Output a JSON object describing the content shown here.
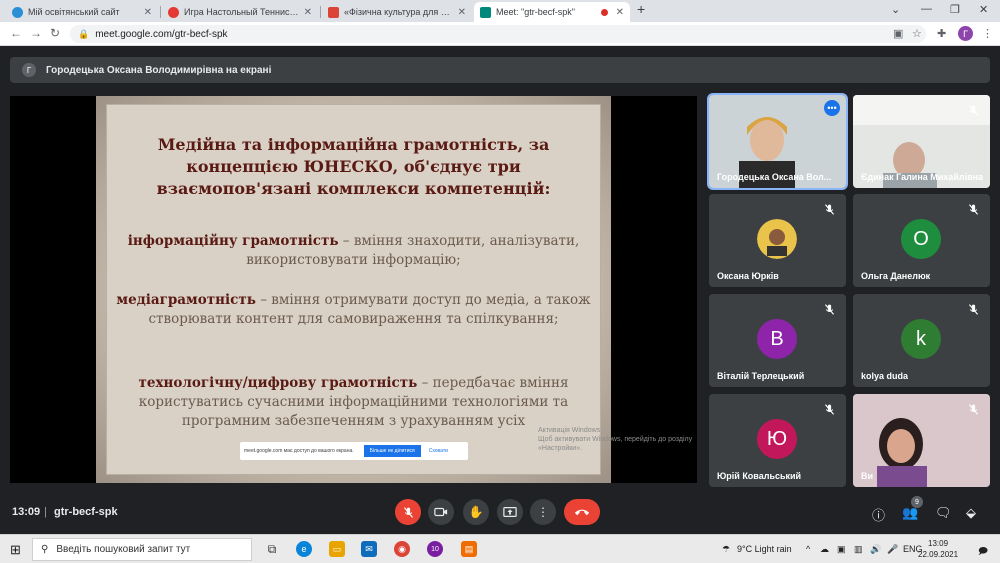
{
  "browser": {
    "tabs": [
      {
        "title": "Мій освітянський сайт",
        "favicon_color": "#2a8fd6",
        "active": false
      },
      {
        "title": "Игра Настольный Теннис: Мир...",
        "favicon_color": "#e53935",
        "active": false
      },
      {
        "title": "«Фізична культура для «поколі...",
        "favicon_color": "#db4437",
        "active": false
      },
      {
        "title": "Meet: \"gtr-becf-spk\"",
        "favicon_color": "#00897b",
        "active": true
      }
    ],
    "new_tab_icon": "plus-icon",
    "url": "meet.google.com/gtr-becf-spk",
    "profile_initial": "Г"
  },
  "meet": {
    "presenter_initial": "Г",
    "presenter_text": "Городецька Оксана Володимирівна на екрані",
    "slide": {
      "title_lines": [
        "Медійна та інформаційна грамотність, за",
        "концепцією ЮНЕСКО, об'єднує три",
        "взаємопов'язані комплекси компетенцій:"
      ],
      "p1_bold": "інформаційну грамотність",
      "p1_rest": " – вміння знаходити, аналізувати, використовувати інформацію;",
      "p2_bold": "медіаграмотність",
      "p2_rest": " – вміння отримувати доступ до медіа, а також створювати контент для самовираження та спілкування;",
      "p3_bold": "технологічну/цифрову грамотність",
      "p3_rest": " – передбачає вміння користуватись сучасними інформаційними технологіями та програмним забезпеченням з урахуванням усіх"
    },
    "share_notice": {
      "text": "meet.google.com має доступ до вашого екрана.",
      "stop_label": "Більше не ділитися",
      "hide_label": "Сховати"
    },
    "activate_windows": [
      "Активація Windows",
      "Щоб активувати Windows, перейдіть до розділу «Настройки»."
    ],
    "participants": [
      {
        "name": "Городецька Оксана Вол...",
        "initial": "",
        "color": "#9c8a80",
        "video": true,
        "muted": false
      },
      {
        "name": "Єдинак Галина Михайлівна",
        "initial": "",
        "color": "#bfbfbf",
        "video": true,
        "muted": true
      },
      {
        "name": "Оксана Юрків",
        "initial": "",
        "color": "#d4a017",
        "video": false,
        "muted": true
      },
      {
        "name": "Ольга Данелюк",
        "initial": "О",
        "color": "#1e8e3e",
        "video": false,
        "muted": true
      },
      {
        "name": "Віталій Терлецький",
        "initial": "В",
        "color": "#8e24aa",
        "video": false,
        "muted": true
      },
      {
        "name": "kolya duda",
        "initial": "k",
        "color": "#2e7d32",
        "video": false,
        "muted": true
      },
      {
        "name": "Юрій Ковальський",
        "initial": "Ю",
        "color": "#c2185b",
        "video": false,
        "muted": true
      },
      {
        "name": "Ви",
        "initial": "",
        "color": "#c9b0b8",
        "video": true,
        "muted": true
      }
    ],
    "controls": {
      "time": "13:09",
      "separator": "|",
      "meeting_code": "gtr-becf-spk",
      "people_count": "9"
    }
  },
  "taskbar": {
    "search_placeholder": "Введіть пошуковий запит тут",
    "app_badge": "10",
    "weather": "9°C  Light rain",
    "language": "ENG",
    "time": "13:09",
    "date": "22.09.2021"
  }
}
